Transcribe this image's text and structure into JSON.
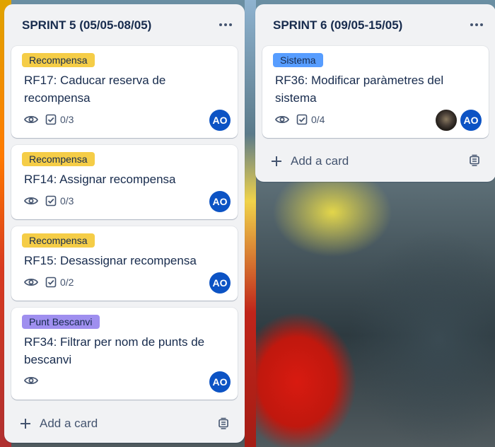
{
  "lists": [
    {
      "title": "SPRINT 5 (05/05-08/05)",
      "add_card_label": "Add a card",
      "cards": [
        {
          "label": "Recompensa",
          "title": "RF17: Caducar reserva de recompensa",
          "checklist": "0/3",
          "avatar": "AO"
        },
        {
          "label": "Recompensa",
          "title": "RF14: Assignar recompensa",
          "checklist": "0/3",
          "avatar": "AO"
        },
        {
          "label": "Recompensa",
          "title": "RF15: Desassignar recompensa",
          "checklist": "0/2",
          "avatar": "AO"
        },
        {
          "label": "Punt Bescanvi",
          "title": "RF34: Filtrar per nom de punts de bescanvi",
          "avatar": "AO"
        }
      ]
    },
    {
      "title": "SPRINT 6 (09/05-15/05)",
      "add_card_label": "Add a card",
      "cards": [
        {
          "label": "Sistema",
          "title": "RF36: Modificar paràmetres del sistema",
          "checklist": "0/4",
          "avatar": "AO"
        }
      ]
    }
  ],
  "colors": {
    "label_yellow": "#f5cd47",
    "label_purple": "#9f8fef",
    "label_blue": "#579dff",
    "avatar": "#0c53c4"
  },
  "icons": [
    "eye-icon",
    "checklist-icon",
    "plus-icon",
    "card-template-icon",
    "more-icon"
  ]
}
